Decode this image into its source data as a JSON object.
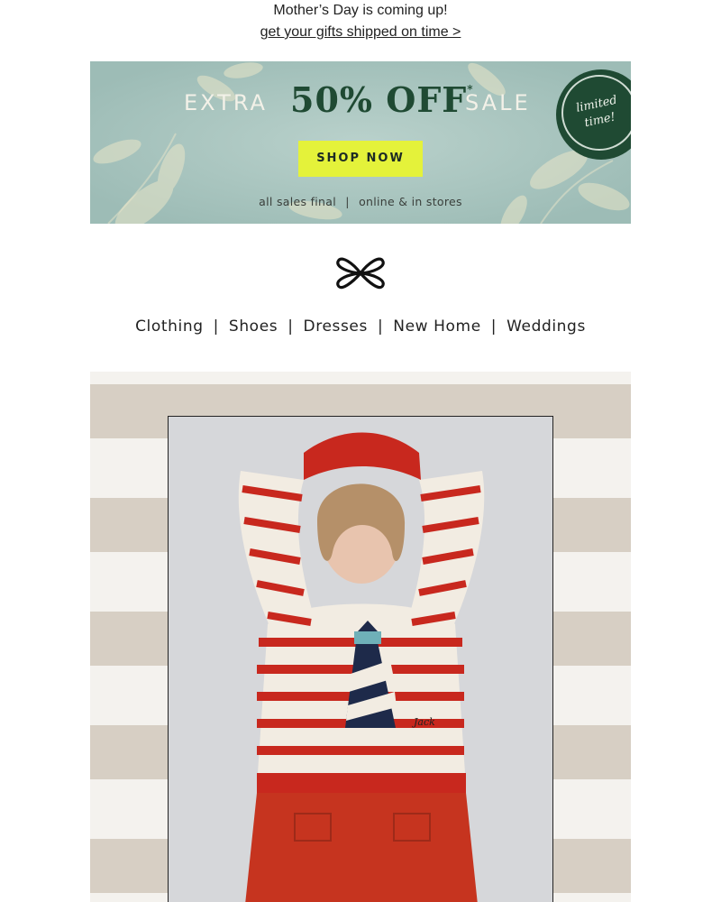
{
  "announcement": {
    "line1": "Mother’s Day is coming up!",
    "link_text": "get your gifts shipped on time >"
  },
  "banner": {
    "extra": "EXTRA",
    "percent": "50% OFF",
    "asterisk": "*",
    "sale": "SALE",
    "cta": "SHOP NOW",
    "badge_line1": "limited",
    "badge_line2": "time!",
    "fine_left": "all sales final",
    "fine_sep": "|",
    "fine_right": "online & in stores",
    "colors": {
      "background": "#a9c4bf",
      "headline_green": "#1f4a33",
      "cta_yellow": "#e4f23a"
    }
  },
  "logo": {
    "icon": "bow-logo-icon"
  },
  "nav": {
    "separator": "|",
    "items": [
      {
        "label": "Clothing"
      },
      {
        "label": "Shoes"
      },
      {
        "label": "Dresses"
      },
      {
        "label": "New Home"
      },
      {
        "label": "Weddings"
      }
    ]
  },
  "hero": {
    "sweater_text": "Jack",
    "colors": {
      "stripe_beige": "#d7cfc4",
      "stripe_white": "#f4f2ee",
      "sweater_red": "#c8281e",
      "pants_red": "#c6341f"
    }
  }
}
